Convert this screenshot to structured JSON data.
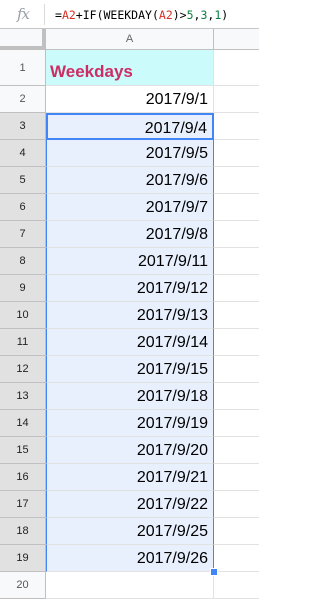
{
  "formula_bar": {
    "icon": "fx-icon",
    "formula_parts": [
      {
        "text": "=",
        "kind": "plain"
      },
      {
        "text": "A2",
        "kind": "ref"
      },
      {
        "text": "+IF(WEEKDAY(",
        "kind": "plain"
      },
      {
        "text": "A2",
        "kind": "ref"
      },
      {
        "text": ")>",
        "kind": "plain"
      },
      {
        "text": "5",
        "kind": "num"
      },
      {
        "text": ",",
        "kind": "plain"
      },
      {
        "text": "3",
        "kind": "num"
      },
      {
        "text": ",",
        "kind": "plain"
      },
      {
        "text": "1",
        "kind": "num"
      },
      {
        "text": ")",
        "kind": "plain"
      }
    ]
  },
  "sheet": {
    "column_label": "A",
    "colors": {
      "header_fill": "#ccfbfb",
      "header_text": "#cc2d64",
      "selection_fill": "#e8f0fe",
      "selection_border": "#4285f4"
    },
    "rows": [
      {
        "num": "1",
        "value": "Weekdays",
        "style": "header"
      },
      {
        "num": "2",
        "value": "2017/9/1",
        "style": "normal"
      },
      {
        "num": "3",
        "value": "2017/9/4",
        "style": "active"
      },
      {
        "num": "4",
        "value": "2017/9/5",
        "style": "range"
      },
      {
        "num": "5",
        "value": "2017/9/6",
        "style": "range"
      },
      {
        "num": "6",
        "value": "2017/9/7",
        "style": "range"
      },
      {
        "num": "7",
        "value": "2017/9/8",
        "style": "range"
      },
      {
        "num": "8",
        "value": "2017/9/11",
        "style": "range"
      },
      {
        "num": "9",
        "value": "2017/9/12",
        "style": "range"
      },
      {
        "num": "10",
        "value": "2017/9/13",
        "style": "range"
      },
      {
        "num": "11",
        "value": "2017/9/14",
        "style": "range"
      },
      {
        "num": "12",
        "value": "2017/9/15",
        "style": "range"
      },
      {
        "num": "13",
        "value": "2017/9/18",
        "style": "range"
      },
      {
        "num": "14",
        "value": "2017/9/19",
        "style": "range"
      },
      {
        "num": "15",
        "value": "2017/9/20",
        "style": "range"
      },
      {
        "num": "16",
        "value": "2017/9/21",
        "style": "range"
      },
      {
        "num": "17",
        "value": "2017/9/22",
        "style": "range"
      },
      {
        "num": "18",
        "value": "2017/9/25",
        "style": "range"
      },
      {
        "num": "19",
        "value": "2017/9/26",
        "style": "range"
      },
      {
        "num": "20",
        "value": "",
        "style": "normal"
      }
    ]
  }
}
